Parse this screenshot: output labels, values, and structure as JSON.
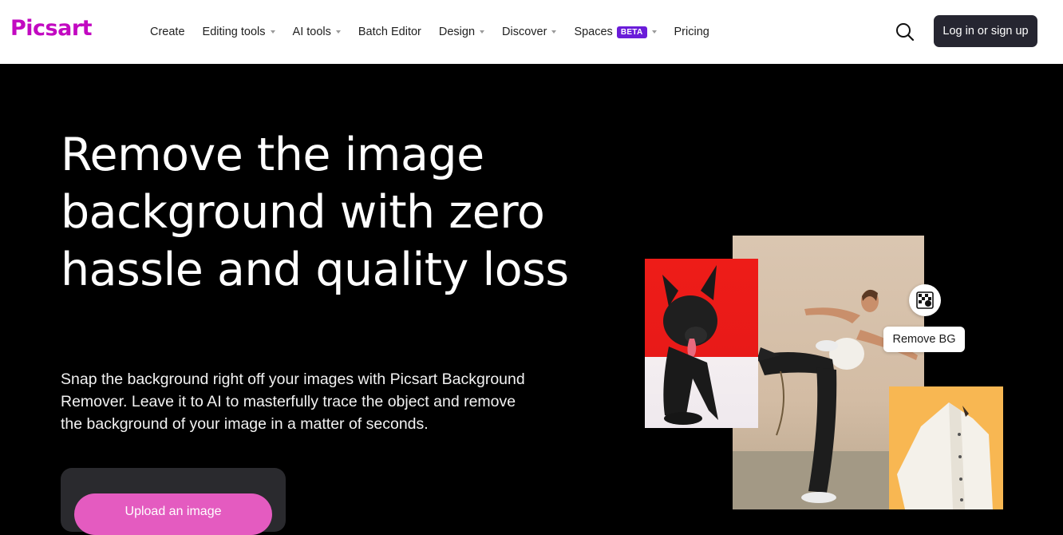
{
  "brand": {
    "logo_text": "Picsart",
    "color": "#c209c1"
  },
  "nav": {
    "items": [
      {
        "label": "Create",
        "dropdown": false
      },
      {
        "label": "Editing tools",
        "dropdown": true
      },
      {
        "label": "AI tools",
        "dropdown": true
      },
      {
        "label": "Batch Editor",
        "dropdown": false
      },
      {
        "label": "Design",
        "dropdown": true
      },
      {
        "label": "Discover",
        "dropdown": true
      },
      {
        "label": "Spaces",
        "badge": "BETA",
        "dropdown": true
      },
      {
        "label": "Pricing",
        "dropdown": false
      }
    ],
    "search_icon": "search-icon",
    "login_label": "Log in or sign up"
  },
  "hero": {
    "title": "Remove the image background with zero hassle and quality loss",
    "description": "Snap the background right off your images with Picsart Background Remover. Leave it to AI to masterfully trace the object and remove the background of your image in a matter of seconds.",
    "upload_label": "Upload an image"
  },
  "showcase": {
    "remove_bg_label": "Remove BG",
    "remove_bg_icon": "checkerboard-icon"
  },
  "colors": {
    "accent": "#c209c1",
    "beta_badge": "#6a1cd9",
    "login_bg": "#262631",
    "upload_btn": "#e45bc0"
  }
}
